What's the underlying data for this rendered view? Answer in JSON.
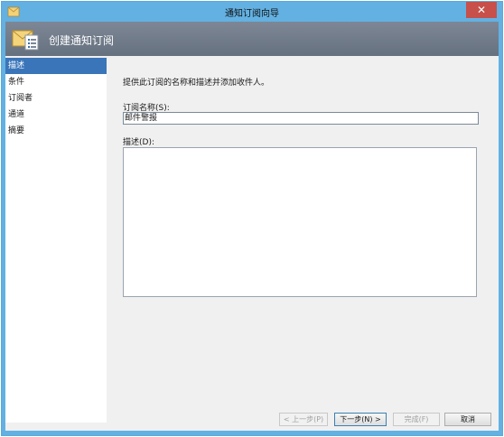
{
  "window": {
    "title": "通知订阅向导",
    "close_glyph": "✕"
  },
  "header": {
    "title": "创建通知订阅",
    "icon": "envelope-list-icon"
  },
  "nav": {
    "items": [
      {
        "label": "描述",
        "active": true
      },
      {
        "label": "条件",
        "active": false
      },
      {
        "label": "订阅者",
        "active": false
      },
      {
        "label": "通道",
        "active": false
      },
      {
        "label": "摘要",
        "active": false
      }
    ]
  },
  "main": {
    "description": "提供此订阅的名称和描述并添加收件人。",
    "name_label": "订阅名称(S):",
    "name_value": "邮件警报",
    "desc_label": "描述(D):",
    "desc_value": ""
  },
  "footer": {
    "prev_label": "< 上一步(P)",
    "next_label": "下一步(N) >",
    "finish_label": "完成(F)",
    "cancel_label": "取消"
  },
  "colors": {
    "title_bar": "#63b1e2",
    "header_bg": "#6f7a88",
    "nav_active": "#3a75b9",
    "close_button": "#c7504a"
  }
}
